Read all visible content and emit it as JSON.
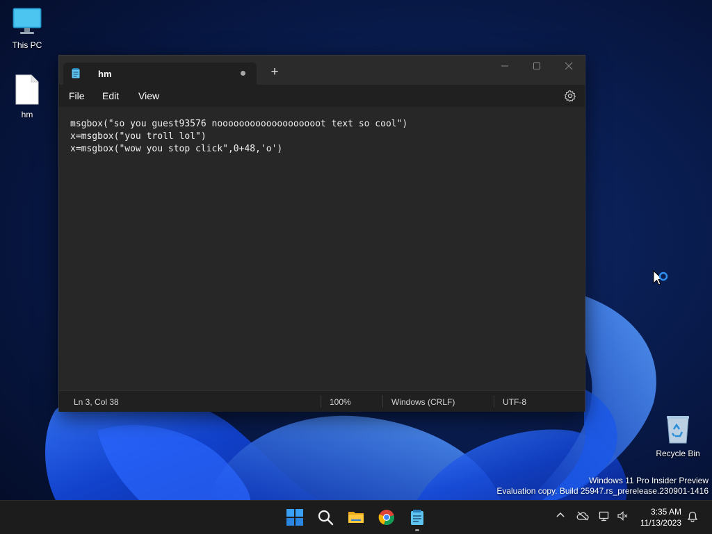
{
  "desktop": {
    "icons": [
      {
        "label": "This PC"
      },
      {
        "label": "hm"
      },
      {
        "label": "Recycle Bin"
      }
    ]
  },
  "notepad": {
    "tab_title": "hm",
    "new_tab": "+",
    "menu": [
      "File",
      "Edit",
      "View"
    ],
    "content_lines": [
      "msgbox(\"so you guest93576 nooooooooooooooooooot text so cool\")",
      "x=msgbox(\"you troll lol\")",
      "x=msgbox(\"wow you stop click\",0+48,'o')"
    ],
    "status": {
      "position": "Ln 3, Col 38",
      "zoom": "100%",
      "line_ending": "Windows (CRLF)",
      "encoding": "UTF-8"
    }
  },
  "watermark": {
    "line1": "Windows 11 Pro Insider Preview",
    "line2": "Evaluation copy. Build 25947.rs_prerelease.230901-1416"
  },
  "taskbar": {
    "apps": [
      "start-icon",
      "search-icon",
      "file-explorer-icon",
      "chrome-icon",
      "notepad-icon"
    ],
    "clock": {
      "time": "3:35 AM",
      "date": "11/13/2023"
    }
  },
  "colors": {
    "accent": "#0078d4",
    "window_bg": "#202020",
    "editor_bg": "#272727"
  }
}
